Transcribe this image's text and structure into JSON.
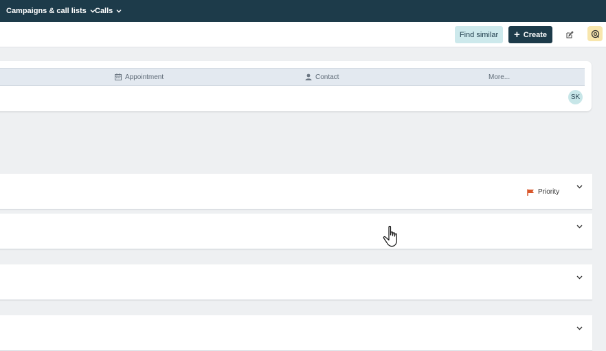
{
  "topnav": {
    "items": [
      {
        "label": "Campaigns & call lists",
        "icon": "chevron-down-icon"
      },
      {
        "label": "Calls",
        "icon": "chevron-down-icon"
      }
    ]
  },
  "toolbar": {
    "find_similar_label": "Find similar",
    "create_label": "Create",
    "create_icon": "plus-icon",
    "edit_icon": "edit-icon",
    "help_icon": "support-icon"
  },
  "activity_tabs": [
    {
      "label": "Appointment",
      "icon": "calendar-icon"
    },
    {
      "label": "Contact",
      "icon": "person-icon"
    },
    {
      "label": "More...",
      "icon": ""
    }
  ],
  "avatar": {
    "initials": "SK"
  },
  "panels": [
    {
      "priority_label": "Priority",
      "priority_icon": "flag-icon"
    },
    {},
    {},
    {}
  ],
  "colors": {
    "nav_bg": "#1d3b4a",
    "find_similar_bg": "#cde9ec",
    "create_bg": "#1d3b4a",
    "help_bg": "#f8e6ad",
    "priority_flag": "#d9572b",
    "tabs_bg": "#e3e9f0",
    "avatar_bg": "#c7e6e8"
  }
}
